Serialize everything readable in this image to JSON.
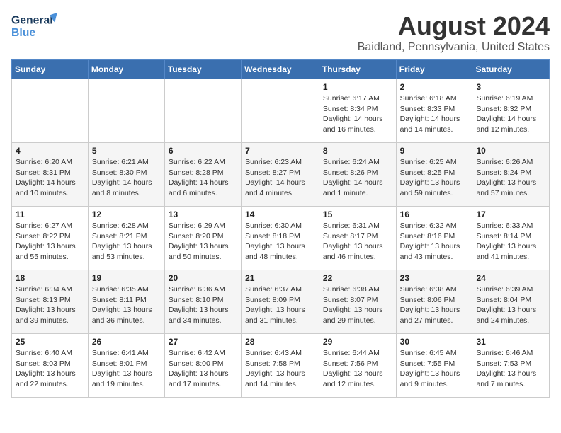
{
  "logo": {
    "line1": "General",
    "line2": "Blue"
  },
  "header": {
    "month": "August 2024",
    "location": "Baidland, Pennsylvania, United States"
  },
  "weekdays": [
    "Sunday",
    "Monday",
    "Tuesday",
    "Wednesday",
    "Thursday",
    "Friday",
    "Saturday"
  ],
  "weeks": [
    [
      {
        "day": "",
        "info": ""
      },
      {
        "day": "",
        "info": ""
      },
      {
        "day": "",
        "info": ""
      },
      {
        "day": "",
        "info": ""
      },
      {
        "day": "1",
        "info": "Sunrise: 6:17 AM\nSunset: 8:34 PM\nDaylight: 14 hours\nand 16 minutes."
      },
      {
        "day": "2",
        "info": "Sunrise: 6:18 AM\nSunset: 8:33 PM\nDaylight: 14 hours\nand 14 minutes."
      },
      {
        "day": "3",
        "info": "Sunrise: 6:19 AM\nSunset: 8:32 PM\nDaylight: 14 hours\nand 12 minutes."
      }
    ],
    [
      {
        "day": "4",
        "info": "Sunrise: 6:20 AM\nSunset: 8:31 PM\nDaylight: 14 hours\nand 10 minutes."
      },
      {
        "day": "5",
        "info": "Sunrise: 6:21 AM\nSunset: 8:30 PM\nDaylight: 14 hours\nand 8 minutes."
      },
      {
        "day": "6",
        "info": "Sunrise: 6:22 AM\nSunset: 8:28 PM\nDaylight: 14 hours\nand 6 minutes."
      },
      {
        "day": "7",
        "info": "Sunrise: 6:23 AM\nSunset: 8:27 PM\nDaylight: 14 hours\nand 4 minutes."
      },
      {
        "day": "8",
        "info": "Sunrise: 6:24 AM\nSunset: 8:26 PM\nDaylight: 14 hours\nand 1 minute."
      },
      {
        "day": "9",
        "info": "Sunrise: 6:25 AM\nSunset: 8:25 PM\nDaylight: 13 hours\nand 59 minutes."
      },
      {
        "day": "10",
        "info": "Sunrise: 6:26 AM\nSunset: 8:24 PM\nDaylight: 13 hours\nand 57 minutes."
      }
    ],
    [
      {
        "day": "11",
        "info": "Sunrise: 6:27 AM\nSunset: 8:22 PM\nDaylight: 13 hours\nand 55 minutes."
      },
      {
        "day": "12",
        "info": "Sunrise: 6:28 AM\nSunset: 8:21 PM\nDaylight: 13 hours\nand 53 minutes."
      },
      {
        "day": "13",
        "info": "Sunrise: 6:29 AM\nSunset: 8:20 PM\nDaylight: 13 hours\nand 50 minutes."
      },
      {
        "day": "14",
        "info": "Sunrise: 6:30 AM\nSunset: 8:18 PM\nDaylight: 13 hours\nand 48 minutes."
      },
      {
        "day": "15",
        "info": "Sunrise: 6:31 AM\nSunset: 8:17 PM\nDaylight: 13 hours\nand 46 minutes."
      },
      {
        "day": "16",
        "info": "Sunrise: 6:32 AM\nSunset: 8:16 PM\nDaylight: 13 hours\nand 43 minutes."
      },
      {
        "day": "17",
        "info": "Sunrise: 6:33 AM\nSunset: 8:14 PM\nDaylight: 13 hours\nand 41 minutes."
      }
    ],
    [
      {
        "day": "18",
        "info": "Sunrise: 6:34 AM\nSunset: 8:13 PM\nDaylight: 13 hours\nand 39 minutes."
      },
      {
        "day": "19",
        "info": "Sunrise: 6:35 AM\nSunset: 8:11 PM\nDaylight: 13 hours\nand 36 minutes."
      },
      {
        "day": "20",
        "info": "Sunrise: 6:36 AM\nSunset: 8:10 PM\nDaylight: 13 hours\nand 34 minutes."
      },
      {
        "day": "21",
        "info": "Sunrise: 6:37 AM\nSunset: 8:09 PM\nDaylight: 13 hours\nand 31 minutes."
      },
      {
        "day": "22",
        "info": "Sunrise: 6:38 AM\nSunset: 8:07 PM\nDaylight: 13 hours\nand 29 minutes."
      },
      {
        "day": "23",
        "info": "Sunrise: 6:38 AM\nSunset: 8:06 PM\nDaylight: 13 hours\nand 27 minutes."
      },
      {
        "day": "24",
        "info": "Sunrise: 6:39 AM\nSunset: 8:04 PM\nDaylight: 13 hours\nand 24 minutes."
      }
    ],
    [
      {
        "day": "25",
        "info": "Sunrise: 6:40 AM\nSunset: 8:03 PM\nDaylight: 13 hours\nand 22 minutes."
      },
      {
        "day": "26",
        "info": "Sunrise: 6:41 AM\nSunset: 8:01 PM\nDaylight: 13 hours\nand 19 minutes."
      },
      {
        "day": "27",
        "info": "Sunrise: 6:42 AM\nSunset: 8:00 PM\nDaylight: 13 hours\nand 17 minutes."
      },
      {
        "day": "28",
        "info": "Sunrise: 6:43 AM\nSunset: 7:58 PM\nDaylight: 13 hours\nand 14 minutes."
      },
      {
        "day": "29",
        "info": "Sunrise: 6:44 AM\nSunset: 7:56 PM\nDaylight: 13 hours\nand 12 minutes."
      },
      {
        "day": "30",
        "info": "Sunrise: 6:45 AM\nSunset: 7:55 PM\nDaylight: 13 hours\nand 9 minutes."
      },
      {
        "day": "31",
        "info": "Sunrise: 6:46 AM\nSunset: 7:53 PM\nDaylight: 13 hours\nand 7 minutes."
      }
    ]
  ]
}
